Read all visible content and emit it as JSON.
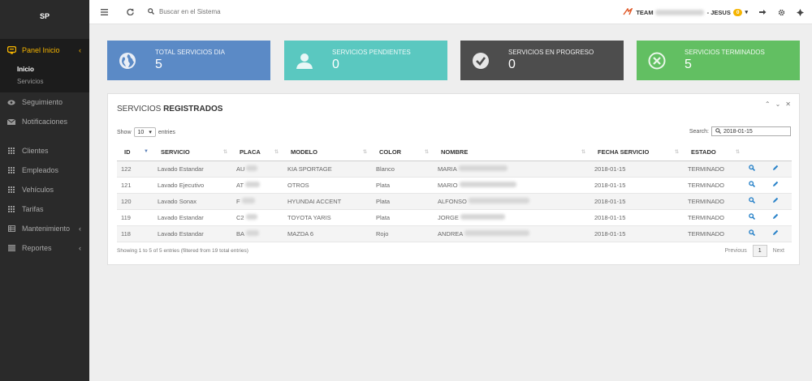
{
  "brand": "SP",
  "sidebar": {
    "items": [
      {
        "label": "Panel Inicio",
        "icon": "dashboard-icon",
        "active": true
      },
      {
        "label": "Seguimiento",
        "icon": "eye-icon"
      },
      {
        "label": "Notificaciones",
        "icon": "envelope-icon"
      },
      {
        "label": "Clientes",
        "icon": "grid-icon"
      },
      {
        "label": "Empleados",
        "icon": "grid-icon"
      },
      {
        "label": "Vehículos",
        "icon": "grid-icon"
      },
      {
        "label": "Tarifas",
        "icon": "grid-icon"
      },
      {
        "label": "Mantenimiento",
        "icon": "table-icon"
      },
      {
        "label": "Reportes",
        "icon": "list-icon"
      }
    ],
    "submenu": [
      "Inicio",
      "Servicios"
    ]
  },
  "topbar": {
    "search_placeholder": "Buscar en el Sistema",
    "team_label": "TEAM",
    "user_label": "JESUS",
    "user_badge": "0"
  },
  "cards": [
    {
      "label": "TOTAL SERVICIOS DIA",
      "value": "5",
      "color": "#5b8ac6",
      "icon": "globe-icon"
    },
    {
      "label": "SERVICIOS PENDIENTES",
      "value": "0",
      "color": "#5ac8c0",
      "icon": "user-icon"
    },
    {
      "label": "SERVICIOS EN PROGRESO",
      "value": "0",
      "color": "#4d4d4d",
      "icon": "check-circle-icon"
    },
    {
      "label": "SERVICIOS TERMINADOS",
      "value": "5",
      "color": "#62bf62",
      "icon": "close-circle-icon"
    }
  ],
  "panel": {
    "title_light": "SERVICIOS",
    "title_bold": "REGISTRADOS",
    "show_label": "Show",
    "entries_value": "10",
    "entries_label": "entries",
    "search_label": "Search:",
    "search_value": "2018-01-15"
  },
  "table": {
    "headers": [
      "ID",
      "SERVICIO",
      "PLACA",
      "MODELO",
      "COLOR",
      "NOMBRE",
      "FECHA SERVICIO",
      "ESTADO"
    ],
    "rows": [
      {
        "id": "122",
        "servicio": "Lavado Estandar",
        "placa": "AU",
        "modelo": "KIA SPORTAGE",
        "color": "Blanco",
        "nombre": "MARIA",
        "fecha": "2018-01-15",
        "estado": "TERMINADO"
      },
      {
        "id": "121",
        "servicio": "Lavado Ejecutivo",
        "placa": "AT",
        "modelo": "OTROS",
        "color": "Plata",
        "nombre": "MARIO",
        "fecha": "2018-01-15",
        "estado": "TERMINADO"
      },
      {
        "id": "120",
        "servicio": "Lavado Sonax",
        "placa": "F",
        "modelo": "HYUNDAI ACCENT",
        "color": "Plata",
        "nombre": "ALFONSO",
        "fecha": "2018-01-15",
        "estado": "TERMINADO"
      },
      {
        "id": "119",
        "servicio": "Lavado Estandar",
        "placa": "C2",
        "modelo": "TOYOTA YARIS",
        "color": "Plata",
        "nombre": "JORGE",
        "fecha": "2018-01-15",
        "estado": "TERMINADO"
      },
      {
        "id": "118",
        "servicio": "Lavado Estandar",
        "placa": "BA",
        "modelo": "MAZDA 6",
        "color": "Rojo",
        "nombre": "ANDREA",
        "fecha": "2018-01-15",
        "estado": "TERMINADO"
      }
    ]
  },
  "footer": {
    "info": "Showing 1 to 5 of 5 entries (filtered from 19 total entries)",
    "prev": "Previous",
    "page": "1",
    "next": "Next"
  }
}
